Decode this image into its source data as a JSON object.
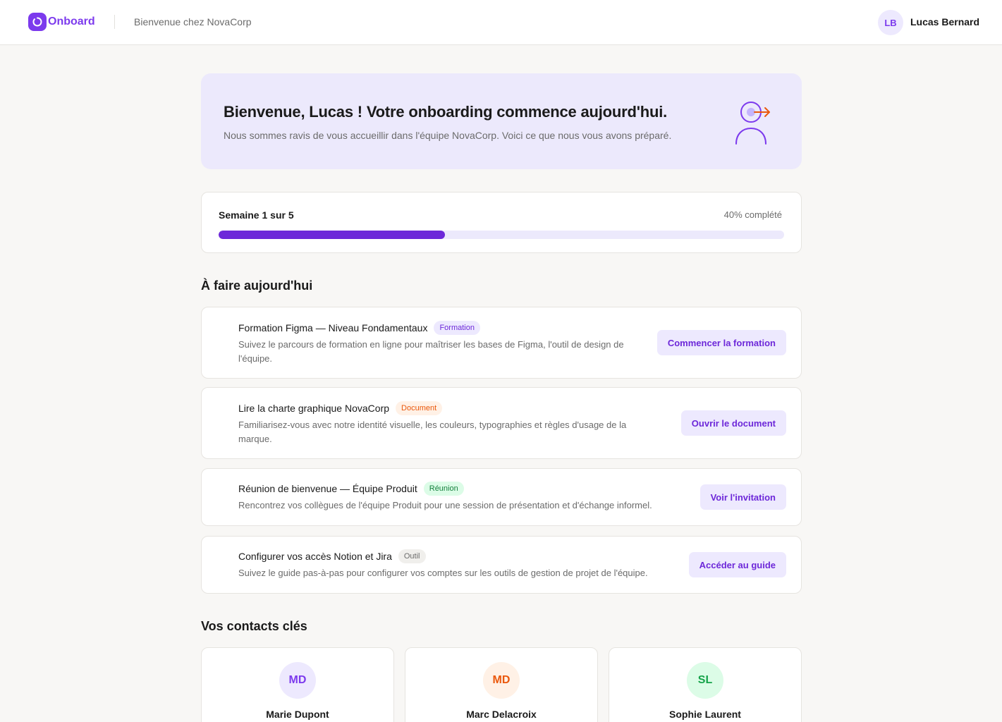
{
  "header": {
    "brand": "Onboard",
    "subtitle": "Bienvenue chez NovaCorp",
    "user_initials": "LB",
    "user_name": "Lucas Bernard"
  },
  "hero": {
    "title": "Bienvenue, Lucas ! Votre onboarding commence aujourd'hui.",
    "subtitle": "Nous sommes ravis de vous accueillir dans l'équipe NovaCorp. Voici ce que nous vous avons préparé.",
    "icon": "user-arrow-icon"
  },
  "progress": {
    "week_label": "Semaine 1 sur 5",
    "percent_label": "40% complété",
    "fraction": 0.4
  },
  "tasks_section": {
    "title": "À faire aujourd'hui",
    "items": [
      {
        "title": "Formation Figma — Niveau Fondamentaux",
        "tag": "Formation",
        "description": "Suivez le parcours de formation en ligne pour maîtriser les bases de Figma, l'outil de design de l'équipe.",
        "button": "Commencer la formation"
      },
      {
        "title": "Lire la charte graphique NovaCorp",
        "tag": "Document",
        "description": "Familiarisez-vous avec notre identité visuelle, les couleurs, typographies et règles d'usage de la marque.",
        "button": "Ouvrir le document"
      },
      {
        "title": "Réunion de bienvenue — Équipe Produit",
        "tag": "Réunion",
        "description": "Rencontrez vos collègues de l'équipe Produit pour une session de présentation et d'échange informel.",
        "button": "Voir l'invitation"
      },
      {
        "title": "Configurer vos accès Notion et Jira",
        "tag": "Outil",
        "description": "Suivez le guide pas-à-pas pour configurer vos comptes sur les outils de gestion de projet de l'équipe.",
        "button": "Accéder au guide"
      }
    ]
  },
  "contacts_section": {
    "title": "Vos contacts clés",
    "items": [
      {
        "initials": "MD",
        "name": "Marie Dupont",
        "color": "#7c3aed",
        "bg": "#ede9fe"
      },
      {
        "initials": "MD",
        "name": "Marc Delacroix",
        "color": "#ea580c",
        "bg": "#fff1e6"
      },
      {
        "initials": "SL",
        "name": "Sophie Laurent",
        "color": "#16a34a",
        "bg": "#dcfce7"
      }
    ]
  },
  "colors": {
    "accent": "#7c3aed",
    "accent_dark": "#6d28d9",
    "hero_bg": "#ece9fc",
    "orange": "#ea580c"
  }
}
